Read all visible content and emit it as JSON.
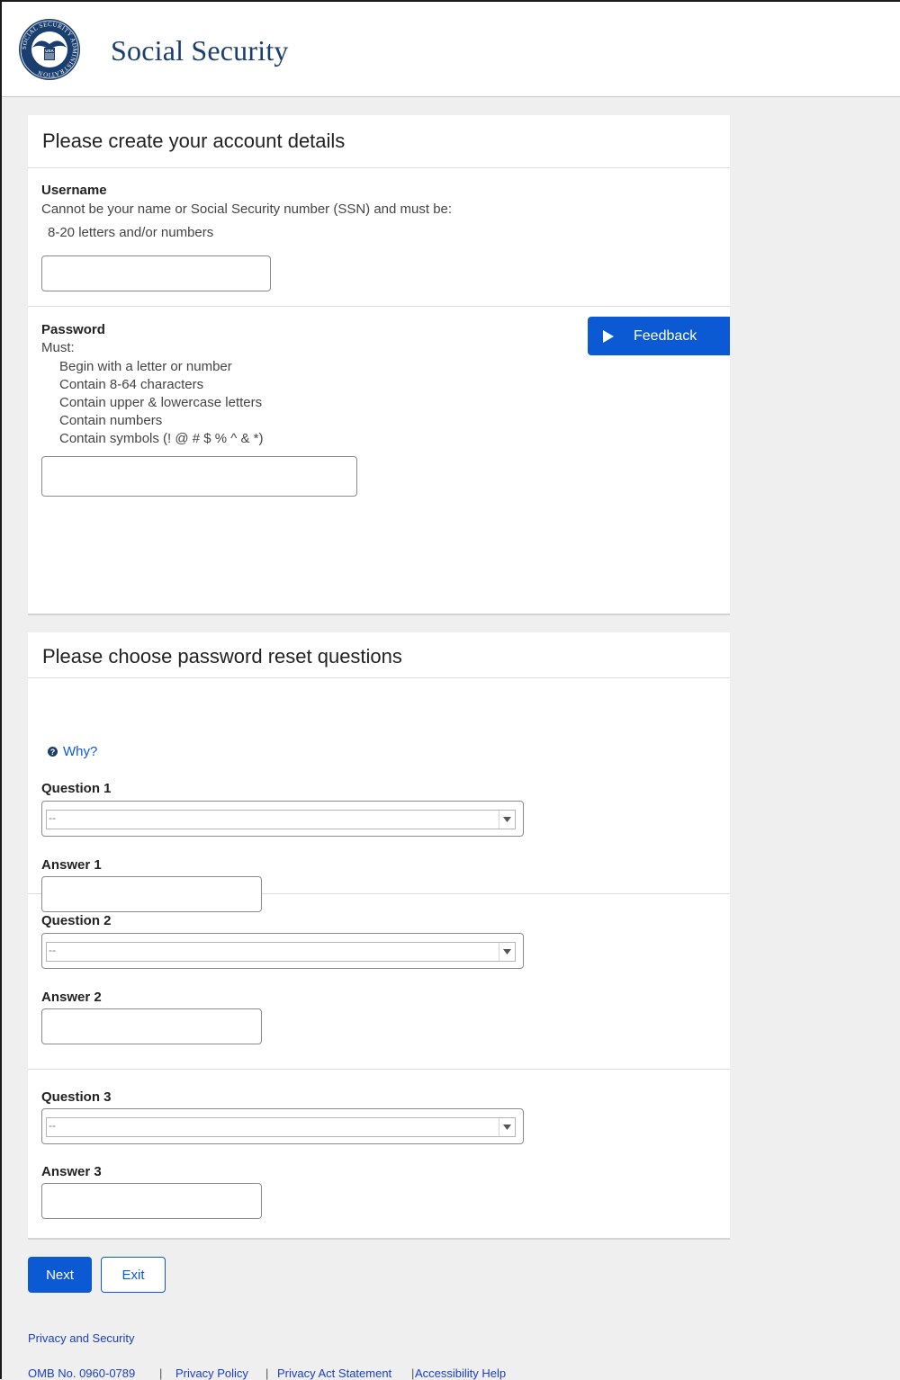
{
  "header": {
    "brand": "Social Security",
    "seal_text": "SOCIAL SECURITY ADMINISTRATION",
    "seal_badge": "USA"
  },
  "account": {
    "title": "Please create your account details",
    "username": {
      "label": "Username",
      "desc": "Cannot be your name or Social Security number (SSN) and must be:",
      "rule": "8-20 letters and/or numbers",
      "value": ""
    },
    "password": {
      "label": "Password",
      "must": "Must:",
      "rules": [
        "Begin with a letter or number",
        "Contain 8-64 characters",
        "Contain upper & lowercase letters",
        "Contain numbers",
        "Contain symbols (! @ # $ % ^ & *)"
      ],
      "value": ""
    }
  },
  "feedback": {
    "label": "Feedback"
  },
  "reset": {
    "title": "Please choose password reset questions",
    "why": "Why?",
    "items": [
      {
        "question_label": "Question 1",
        "selected": "--",
        "answer_label": "Answer 1",
        "answer": ""
      },
      {
        "question_label": "Question 2",
        "selected": "--",
        "answer_label": "Answer 2",
        "answer": ""
      },
      {
        "question_label": "Question 3",
        "selected": "--",
        "answer_label": "Answer 3",
        "answer": ""
      }
    ]
  },
  "actions": {
    "next": "Next",
    "exit": "Exit"
  },
  "footer": {
    "privacy_security": "Privacy and Security",
    "omb": "OMB No. 0960-0789",
    "privacy_policy": "Privacy Policy",
    "privacy_act": "Privacy Act Statement",
    "accessibility": "Accessibility Help",
    "separator": "|"
  },
  "colors": {
    "brand": "#1a3e6e",
    "primary": "#0b5ad3",
    "link": "#1a3fc4",
    "page_bg": "#efefef"
  }
}
